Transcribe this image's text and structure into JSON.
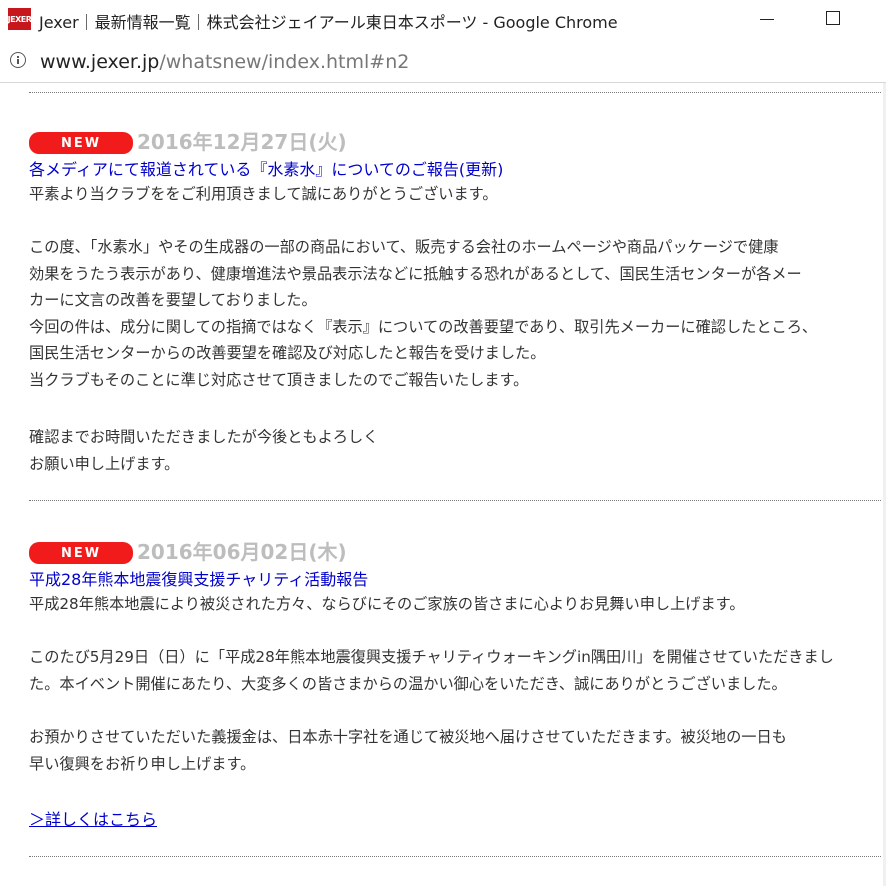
{
  "window": {
    "app_icon_text": "JEXER",
    "title": "Jexer｜最新情報一覧｜株式会社ジェイアール東日本スポーツ - Google Chrome"
  },
  "address": {
    "host": "www.jexer.jp",
    "path": "/whatsnew/index.html#n2"
  },
  "news": [
    {
      "badge": "NEW",
      "date": "2016年12月27日(火)",
      "title": "各メディアにて報道されている『水素水』についてのご報告(更新)",
      "paragraphs": [
        "平素より当クラブををご利用頂きまして誠にありがとうございます。",
        "この度、「水素水」やその生成器の一部の商品において、販売する会社のホームページや商品パッケージで健康\n効果をうたう表示があり、健康増進法や景品表示法などに抵触する恐れがあるとして、国民生活センターが各メー\nカーに文言の改善を要望しておりました。\n今回の件は、成分に関しての指摘ではなく『表示』についての改善要望であり、取引先メーカーに確認したところ、\n国民生活センターからの改善要望を確認及び対応したと報告を受けました。\n当クラブもそのことに準じ対応させて頂きましたのでご報告いたします。",
        "確認までお時間いただきましたが今後ともよろしく\nお願い申し上げます。"
      ]
    },
    {
      "badge": "NEW",
      "date": "2016年06月02日(木)",
      "title": "平成28年熊本地震復興支援チャリティ活動報告",
      "paragraphs": [
        "平成28年熊本地震により被災された方々、ならびにそのご家族の皆さまに心よりお見舞い申し上げます。",
        "このたび5月29日（日）に「平成28年熊本地震復興支援チャリティウォーキングin隅田川」を開催させていただきまし\nた。本イベント開催にあたり、大変多くの皆さまからの温かい御心をいただき、誠にありがとうございました。",
        "お預かりさせていただいた義援金は、日本赤十字社を通じて被災地へ届けさせていただきます。被災地の一日も\n早い復興をお祈り申し上げます。"
      ],
      "more_link": "＞詳しくはこちら"
    }
  ]
}
